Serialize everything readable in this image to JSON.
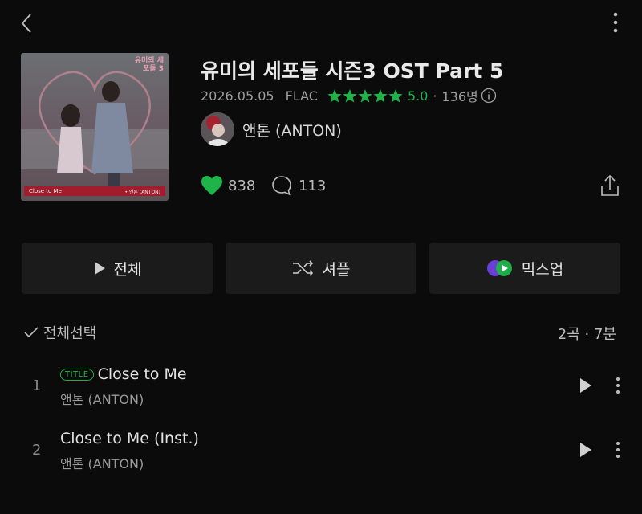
{
  "header": {
    "back_icon": "chevron-left-icon",
    "more_icon": "more-vertical-icon"
  },
  "album": {
    "title": "유미의 세포들 시즌3 OST Part 5",
    "date": "2026.05.05",
    "format": "FLAC",
    "rating": "5.0",
    "rating_count": "136명",
    "artist": "앤톤 (ANTON)",
    "likes": "838",
    "comments": "113",
    "cover_caption_left": "Close to Me",
    "cover_caption_right": "• 앤톤 (ANTON)",
    "cover_logo": "유미의 세포들 3"
  },
  "actions": {
    "play_all": "전체",
    "shuffle": "셔플",
    "mixup": "믹스업"
  },
  "list_header": {
    "select_all": "전체선택",
    "summary": "2곡 · 7분"
  },
  "tracks": [
    {
      "num": "1",
      "badge": "TITLE",
      "title": "Close to Me",
      "artist": "앤톤 (ANTON)"
    },
    {
      "num": "2",
      "badge": "",
      "title": "Close to Me (Inst.)",
      "artist": "앤톤 (ANTON)"
    }
  ],
  "colors": {
    "accent_green": "#1fb44a",
    "background": "#0b0b0b",
    "button_bg": "#1b1b1b"
  }
}
